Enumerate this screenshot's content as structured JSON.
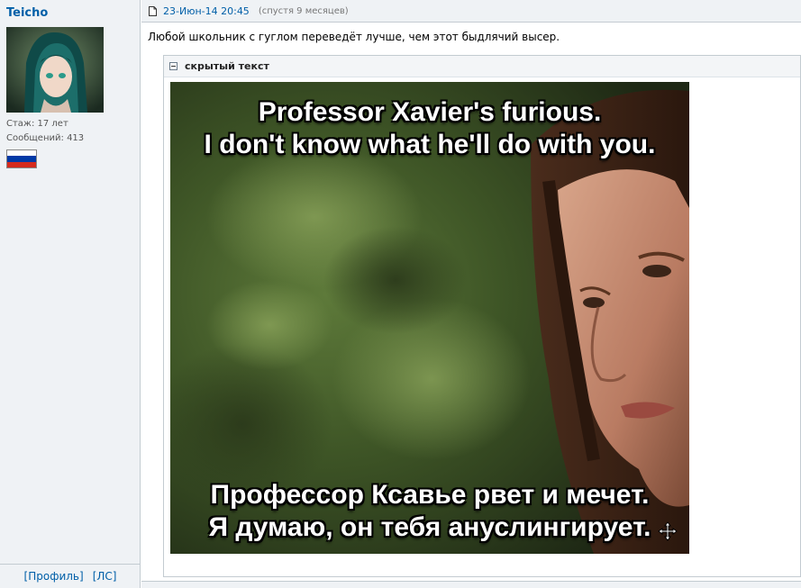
{
  "author": {
    "nick": "Teicho",
    "stage_label": "Стаж:",
    "stage_value": "17 лет",
    "messages_label": "Сообщений:",
    "messages_value": "413",
    "flag_colors": [
      "#ffffff",
      "#0039a6",
      "#d52b1e"
    ],
    "profile_link": "[Профиль]",
    "pm_link": "[ЛС]"
  },
  "post": {
    "date": "23-Июн-14 20:45",
    "late_note": "(спустя 9 месяцев)",
    "text": "Любой школьник с гуглом переведёт лучше, чем этот быдлячий высер.",
    "spoiler_title": "скрытый текст"
  },
  "meme": {
    "top_line_1": "Professor Xavier's furious.",
    "top_line_2": "I don't know what he'll do with you.",
    "bottom_line_1": "Профессор Ксавье рвет и мечет.",
    "bottom_line_2": "Я думаю, он тебя ануслингирует."
  },
  "colors": {
    "link": "#005fa8",
    "panel_bg": "#eff2f5",
    "border": "#c3cbd1"
  }
}
